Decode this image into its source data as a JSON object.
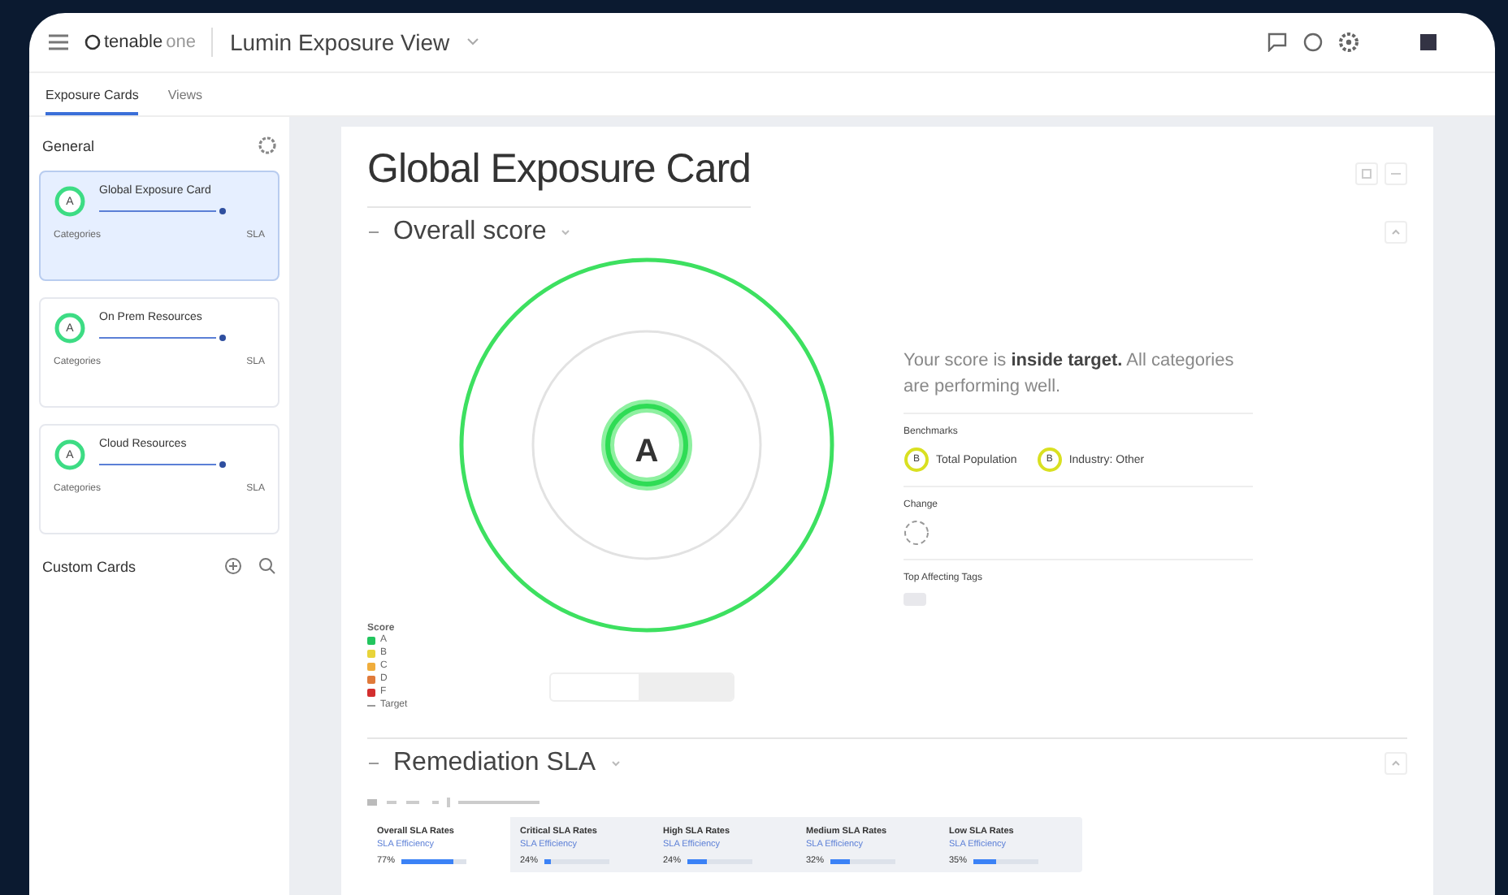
{
  "app": {
    "logo": "tenable",
    "logo_suffix": "one",
    "view_title": "Lumin Exposure View"
  },
  "tabs": [
    {
      "label": "Exposure Cards",
      "selected": true
    },
    {
      "label": "Views",
      "selected": false
    }
  ],
  "sidebar": {
    "general_title": "General",
    "cards": [
      {
        "grade": "A",
        "name": "Global Exposure Card",
        "category_label": "Categories",
        "sla_label": "SLA",
        "selected": true
      },
      {
        "grade": "A",
        "name": "On Prem Resources",
        "category_label": "Categories",
        "sla_label": "SLA",
        "selected": false
      },
      {
        "grade": "A",
        "name": "Cloud Resources",
        "category_label": "Categories",
        "sla_label": "SLA",
        "selected": false
      }
    ],
    "custom_title": "Custom Cards"
  },
  "main": {
    "title": "Global Exposure Card",
    "overall": {
      "title": "Overall score",
      "grade": "A",
      "summary": "Your score is **inside target.** All categories are performing well.",
      "benchmarks_title": "Benchmarks",
      "benchmarks": [
        {
          "grade": "B",
          "name": "Total Population",
          "color": "#d9e021"
        },
        {
          "grade": "B",
          "name": "Industry: Other",
          "color": "#d9e021"
        }
      ],
      "change_title": "Change",
      "tags_title": "Top Affecting Tags",
      "legend_title": "Score",
      "legend": [
        {
          "grade": "A",
          "color": "#22c55e"
        },
        {
          "grade": "B",
          "color": "#e8d43a"
        },
        {
          "grade": "C",
          "color": "#f0ad3c"
        },
        {
          "grade": "D",
          "color": "#e07a3a"
        },
        {
          "grade": "F",
          "color": "#d32f2f"
        }
      ],
      "target_label": "Target"
    },
    "sla": {
      "title": "Remediation SLA",
      "tiles": [
        {
          "name": "Overall SLA Rates",
          "sub": "SLA Efficiency",
          "value": "77%",
          "level": 0.8,
          "selected": true
        },
        {
          "name": "Critical SLA Rates",
          "sub": "SLA Efficiency",
          "value": "24%",
          "level": 0.1,
          "selected": false
        },
        {
          "name": "High SLA Rates",
          "sub": "SLA Efficiency",
          "value": "24%",
          "level": 0.3,
          "selected": false
        },
        {
          "name": "Medium SLA Rates",
          "sub": "SLA Efficiency",
          "value": "32%",
          "level": 0.3,
          "selected": false
        },
        {
          "name": "Low SLA Rates",
          "sub": "SLA Efficiency",
          "value": "35%",
          "level": 0.35,
          "selected": false
        }
      ]
    }
  }
}
